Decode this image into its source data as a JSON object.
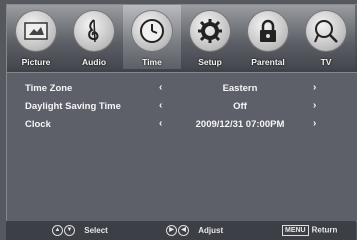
{
  "tabs": [
    {
      "label": "Picture",
      "icon": "picture-icon"
    },
    {
      "label": "Audio",
      "icon": "music-note-icon"
    },
    {
      "label": "Time",
      "icon": "clock-icon",
      "active": true
    },
    {
      "label": "Setup",
      "icon": "gear-icon"
    },
    {
      "label": "Parental",
      "icon": "lock-icon"
    },
    {
      "label": "TV",
      "icon": "satellite-dish-icon"
    }
  ],
  "settings": [
    {
      "label": "Time Zone",
      "value": "Eastern"
    },
    {
      "label": "Daylight Saving Time",
      "value": "Off"
    },
    {
      "label": "Clock",
      "value": "2009/12/31  07:00PM"
    }
  ],
  "arrows": {
    "left": "‹",
    "right": "›"
  },
  "hints": {
    "select": "Select",
    "adjust": "Adjust",
    "menu_key": "MENU",
    "return": "Return"
  }
}
